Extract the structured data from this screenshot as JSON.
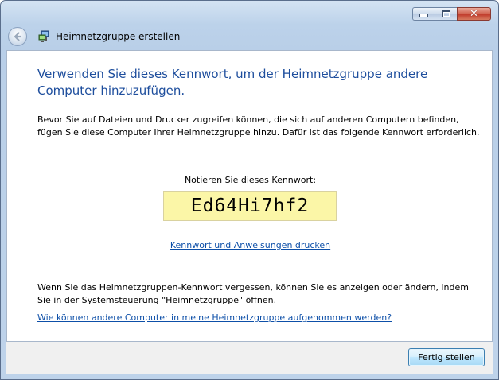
{
  "window": {
    "title": "Heimnetzgruppe erstellen",
    "close_glyph": "✕"
  },
  "content": {
    "heading": "Verwenden Sie dieses Kennwort, um der Heimnetzgruppe andere Computer hinzuzufügen.",
    "intro": "Bevor Sie auf Dateien und Drucker zugreifen können, die sich auf anderen Computern befinden, fügen Sie diese Computer Ihrer Heimnetzgruppe hinzu. Dafür ist das folgende Kennwort erforderlich.",
    "password_label": "Notieren Sie dieses Kennwort:",
    "password": "Ed64Hi7hf2",
    "print_link": "Kennwort und Anweisungen drucken",
    "forgot_text": "Wenn Sie das Heimnetzgruppen-Kennwort vergessen, können Sie es anzeigen oder ändern, indem Sie in der Systemsteuerung \"Heimnetzgruppe\" öffnen.",
    "help_link": "Wie können andere Computer in meine Heimnetzgruppe aufgenommen werden?"
  },
  "footer": {
    "finish_label": "Fertig stellen"
  },
  "colors": {
    "heading": "#1e4e9d",
    "link": "#0d4fa8",
    "password_bg": "#fbf6a7"
  }
}
